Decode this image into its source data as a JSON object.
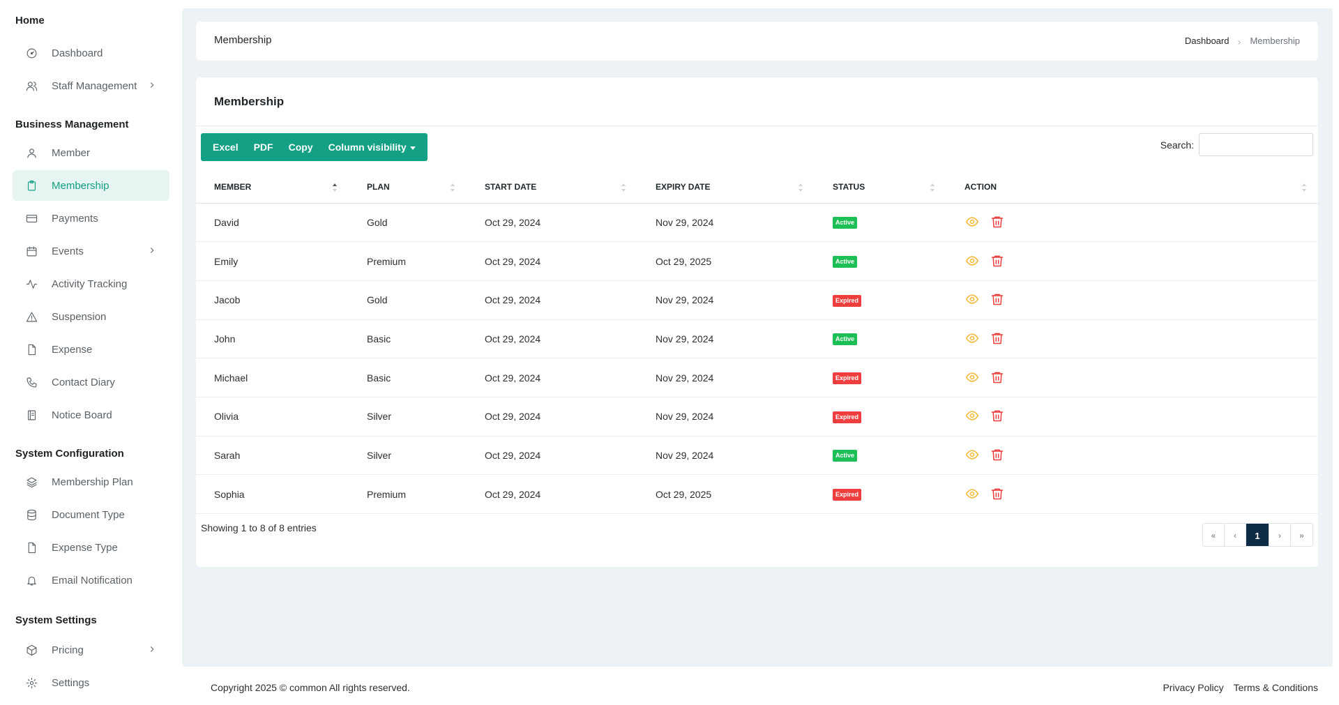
{
  "sidebar": {
    "sections": [
      {
        "title": "Home"
      },
      {
        "title": "Business Management"
      },
      {
        "title": "System Configuration"
      },
      {
        "title": "System Settings"
      }
    ],
    "items": [
      {
        "label": "Dashboard",
        "icon": "dashboard-icon"
      },
      {
        "label": "Staff Management",
        "icon": "users-icon"
      },
      {
        "label": "Member",
        "icon": "user-icon"
      },
      {
        "label": "Membership",
        "icon": "clipboard-icon",
        "active": true
      },
      {
        "label": "Payments",
        "icon": "credit-card-icon"
      },
      {
        "label": "Events",
        "icon": "calendar-icon"
      },
      {
        "label": "Activity Tracking",
        "icon": "activity-icon"
      },
      {
        "label": "Suspension",
        "icon": "alert-triangle-icon"
      },
      {
        "label": "Expense",
        "icon": "file-icon"
      },
      {
        "label": "Contact Diary",
        "icon": "phone-icon"
      },
      {
        "label": "Notice Board",
        "icon": "book-icon"
      },
      {
        "label": "Membership Plan",
        "icon": "layers-icon"
      },
      {
        "label": "Document Type",
        "icon": "database-icon"
      },
      {
        "label": "Expense Type",
        "icon": "file-icon"
      },
      {
        "label": "Email Notification",
        "icon": "bell-icon"
      },
      {
        "label": "Pricing",
        "icon": "package-icon"
      },
      {
        "label": "Settings",
        "icon": "gear-icon"
      }
    ]
  },
  "header": {
    "title": "Membership",
    "breadcrumb": [
      "Dashboard",
      "Membership"
    ]
  },
  "card": {
    "title": "Membership",
    "buttons": [
      "Excel",
      "PDF",
      "Copy",
      "Column visibility"
    ],
    "search_label": "Search:",
    "search_value": ""
  },
  "table": {
    "columns": [
      "MEMBER",
      "PLAN",
      "START DATE",
      "EXPIRY DATE",
      "STATUS",
      "ACTION"
    ],
    "rows": [
      {
        "member": "David",
        "plan": "Gold",
        "start": "Oct 29, 2024",
        "expiry": "Nov 29, 2024",
        "status": "Active"
      },
      {
        "member": "Emily",
        "plan": "Premium",
        "start": "Oct 29, 2024",
        "expiry": "Oct 29, 2025",
        "status": "Active"
      },
      {
        "member": "Jacob",
        "plan": "Gold",
        "start": "Oct 29, 2024",
        "expiry": "Nov 29, 2024",
        "status": "Expired"
      },
      {
        "member": "John",
        "plan": "Basic",
        "start": "Oct 29, 2024",
        "expiry": "Nov 29, 2024",
        "status": "Active"
      },
      {
        "member": "Michael",
        "plan": "Basic",
        "start": "Oct 29, 2024",
        "expiry": "Nov 29, 2024",
        "status": "Expired"
      },
      {
        "member": "Olivia",
        "plan": "Silver",
        "start": "Oct 29, 2024",
        "expiry": "Nov 29, 2024",
        "status": "Expired"
      },
      {
        "member": "Sarah",
        "plan": "Silver",
        "start": "Oct 29, 2024",
        "expiry": "Nov 29, 2024",
        "status": "Active"
      },
      {
        "member": "Sophia",
        "plan": "Premium",
        "start": "Oct 29, 2024",
        "expiry": "Oct 29, 2025",
        "status": "Expired"
      }
    ],
    "showing": "Showing 1 to 8 of 8 entries"
  },
  "pagination": {
    "first": "«",
    "prev": "‹",
    "current": "1",
    "next": "›",
    "last": "»"
  },
  "footer": {
    "copyright": "Copyright 2025 © common All rights reserved.",
    "links": [
      "Privacy Policy",
      "Terms & Conditions"
    ]
  },
  "colors": {
    "accent": "#13a085",
    "active_badge": "#1bbf55",
    "expired_badge": "#ef3e3e",
    "pager_current": "#0d2b45"
  }
}
